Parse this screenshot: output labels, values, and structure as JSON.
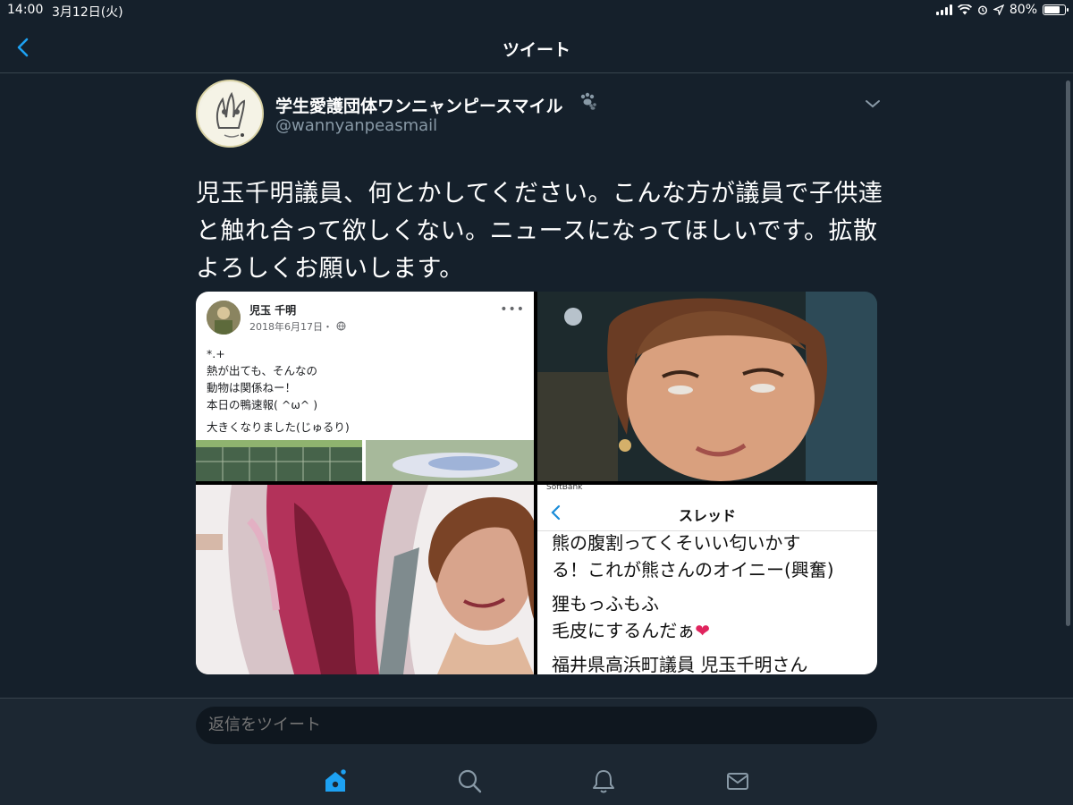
{
  "status_bar": {
    "time": "14:00",
    "date": "3月12日(火)",
    "battery": "80%",
    "battery_level": 0.8
  },
  "nav": {
    "title": "ツイート"
  },
  "tweet": {
    "display_name": "学生愛護団体ワンニャンピースマイル",
    "username": "@wannyanpeasmail",
    "text": "児玉千明議員、何とかしてください。こんな方が議員で子供達と触れ合って欲しくない。ニュースになってほしいです。拡散よろしくお願いします。"
  },
  "media": {
    "fb_post": {
      "name": "児玉 千明",
      "date": "2018年6月17日・",
      "more": "•••",
      "lines": [
        "*.+",
        "熱が出ても、そんなの",
        "動物は関係ねー！",
        "本日の鴨速報( ^ω^ )",
        "大きくなりました(じゅるり)"
      ]
    },
    "chat": {
      "carrier": "SoftBank",
      "title": "スレッド",
      "lines": [
        "熊の腹割ってくそいい匂いかす",
        "る！これが熊さんのオイニー(興奮)",
        "狸もっふもふ",
        "毛皮にするんだぁ",
        "福井県高浜町議員 児玉千明さん"
      ]
    }
  },
  "reply": {
    "placeholder": "返信をツイート"
  },
  "colors": {
    "background": "#15202b",
    "accent": "#1da1f2",
    "secondary_text": "#8899a6"
  }
}
